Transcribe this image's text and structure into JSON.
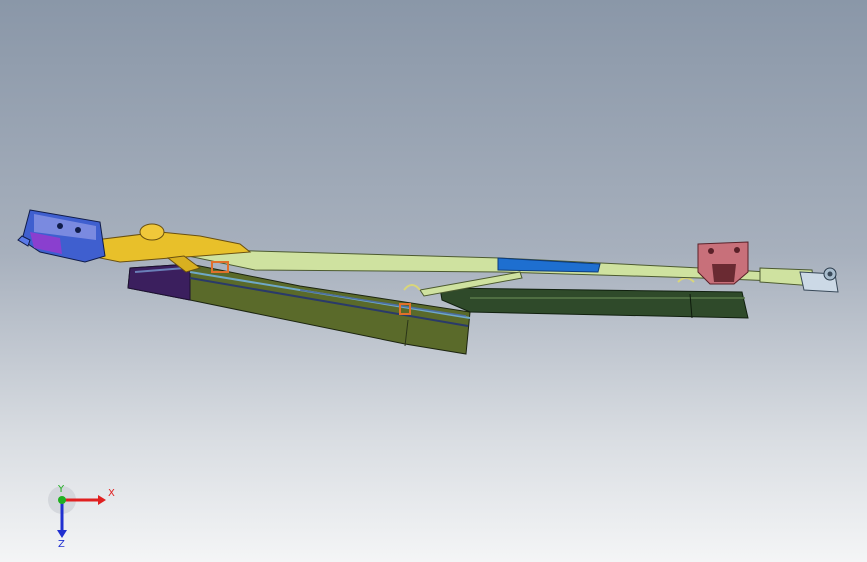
{
  "viewport": {
    "background_top": "#8a97a8",
    "background_bottom": "#f4f5f6"
  },
  "model": {
    "colors": {
      "motor": "#3f5fcf",
      "arm_yellow": "#e8c02a",
      "linkage": "#cfe2a0",
      "blade_left": "#5a6a2a",
      "blade_right": "#2f4a2a",
      "bracket": "#c8707a",
      "rubber_purple": "#3b1f5e",
      "clip_orange": "#e0702a",
      "blue_segment": "#1e6fd0"
    }
  },
  "triad": {
    "x_label": "X",
    "y_label": "Y",
    "z_label": "Z",
    "x_color": "#e02020",
    "y_color": "#20b020",
    "z_color": "#2030d0"
  }
}
